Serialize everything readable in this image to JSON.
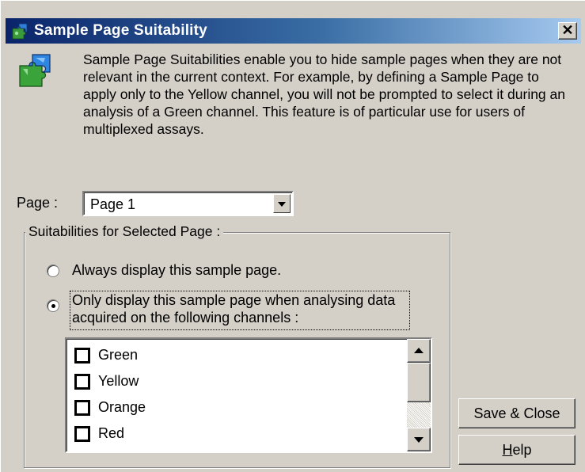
{
  "window": {
    "title": "Sample Page Suitability",
    "close_glyph": "✕"
  },
  "icons": {
    "title_icon": "puzzle-icon",
    "info_icon": "puzzle-icon"
  },
  "description": "Sample Page Suitabilities enable you to hide sample pages when they are not relevant in the current context. For example, by defining a Sample Page to apply only to the Yellow channel, you will not be prompted to select it during an analysis of a Green channel. This feature is of particular use for users of multiplexed assays.",
  "page_select": {
    "label": "Page :",
    "value": "Page 1"
  },
  "suitabilities": {
    "group_title": "Suitabilities for Selected Page :",
    "options": [
      {
        "label": "Always display this sample page.",
        "selected": false
      },
      {
        "label": "Only display this sample page when analysing data acquired on the following channels :",
        "selected": true
      }
    ],
    "channels": [
      {
        "label": "Green",
        "checked": false
      },
      {
        "label": "Yellow",
        "checked": false
      },
      {
        "label": "Orange",
        "checked": false
      },
      {
        "label": "Red",
        "checked": false
      }
    ]
  },
  "buttons": {
    "save_close": "Save & Close",
    "help_prefix": "",
    "help_underlined": "H",
    "help_rest": "elp"
  },
  "colors": {
    "titlebar_start": "#0a246a",
    "titlebar_end": "#a6caf0",
    "face": "#d4d0c8"
  }
}
